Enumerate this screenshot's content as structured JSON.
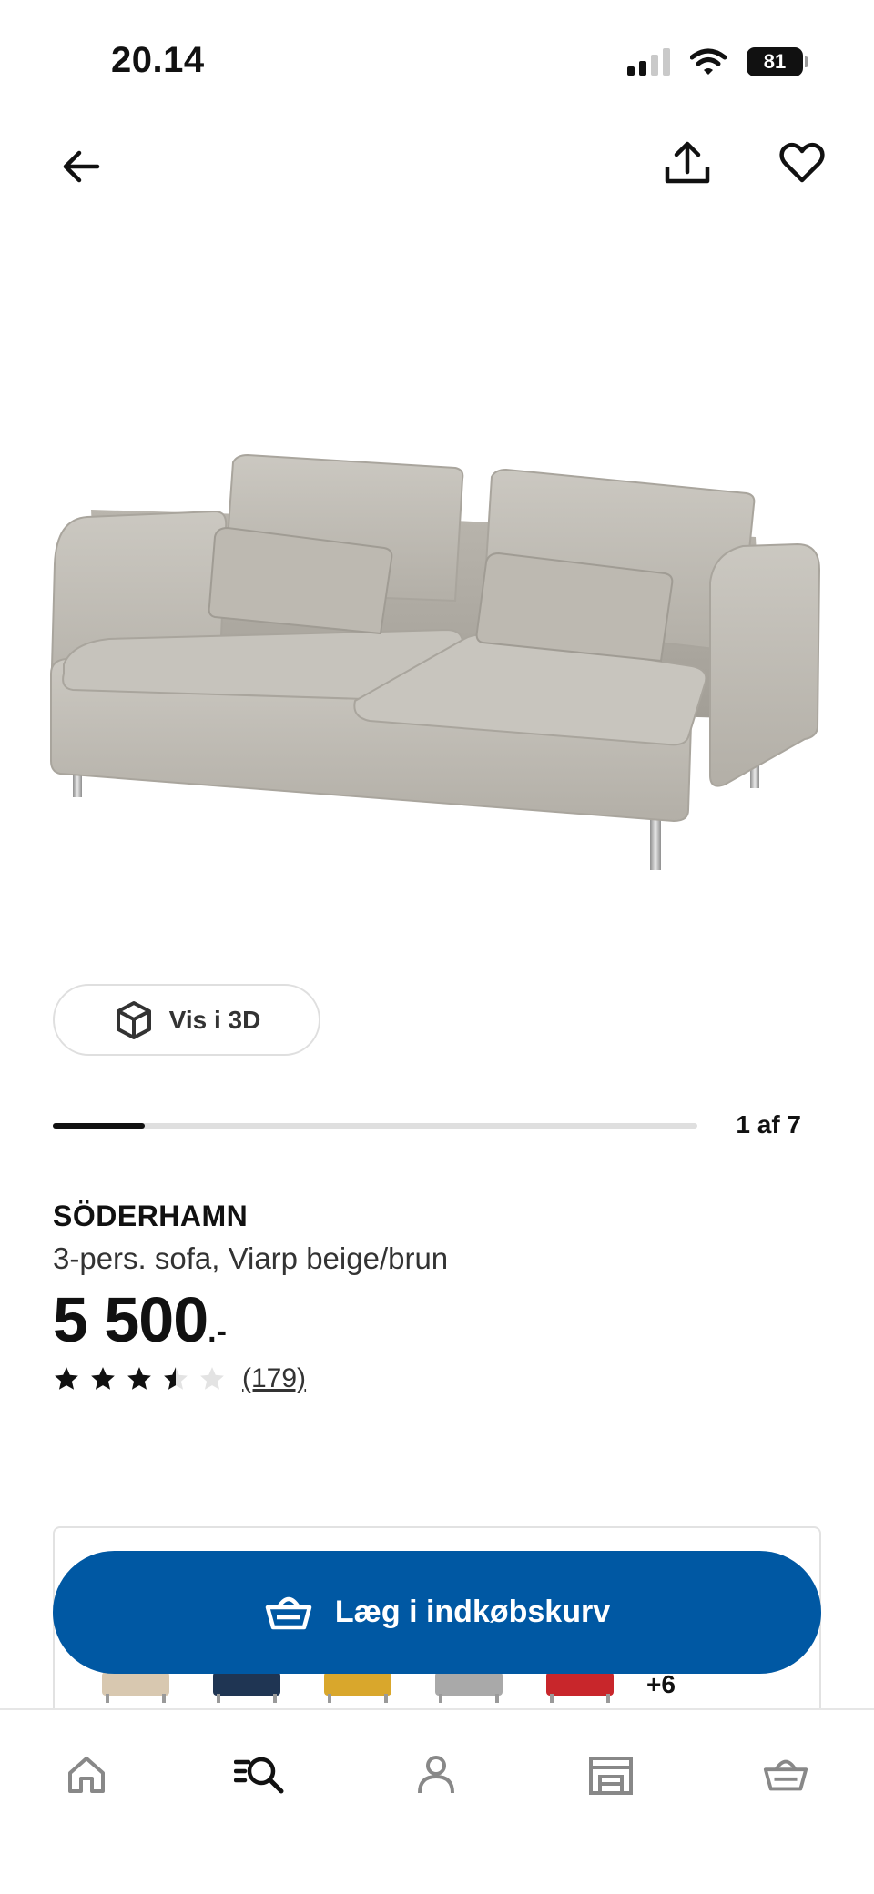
{
  "status_bar": {
    "time": "20.14",
    "battery": "81",
    "icons": [
      "signal-icon",
      "wifi-icon",
      "battery-icon"
    ]
  },
  "top_nav": {
    "icons": [
      "back-arrow-icon",
      "share-icon",
      "heart-icon"
    ]
  },
  "gallery": {
    "view_3d_label": "Vis i 3D",
    "position_label": "1 af 7",
    "current_image": 1,
    "total_images": 7
  },
  "product": {
    "name": "SÖDERHAMN",
    "description": "3-pers. sofa, Viarp beige/brun",
    "price": "5 500",
    "price_suffix": ".-",
    "rating": 3.5,
    "rating_max": 5,
    "review_count": "(179)"
  },
  "variants": {
    "swatch_colors": [
      "#d8c8b0",
      "#1f3553",
      "#d9a72c",
      "#a9a9a9",
      "#c8262b"
    ],
    "more_label": "+6"
  },
  "cart_button": {
    "label": "Læg i indkøbskurv",
    "color": "#0058a3"
  },
  "tab_bar": {
    "items": [
      {
        "icon": "home-icon",
        "active": false
      },
      {
        "icon": "search-list-icon",
        "active": true
      },
      {
        "icon": "profile-icon",
        "active": false
      },
      {
        "icon": "store-icon",
        "active": false
      },
      {
        "icon": "basket-icon",
        "active": false
      }
    ]
  }
}
